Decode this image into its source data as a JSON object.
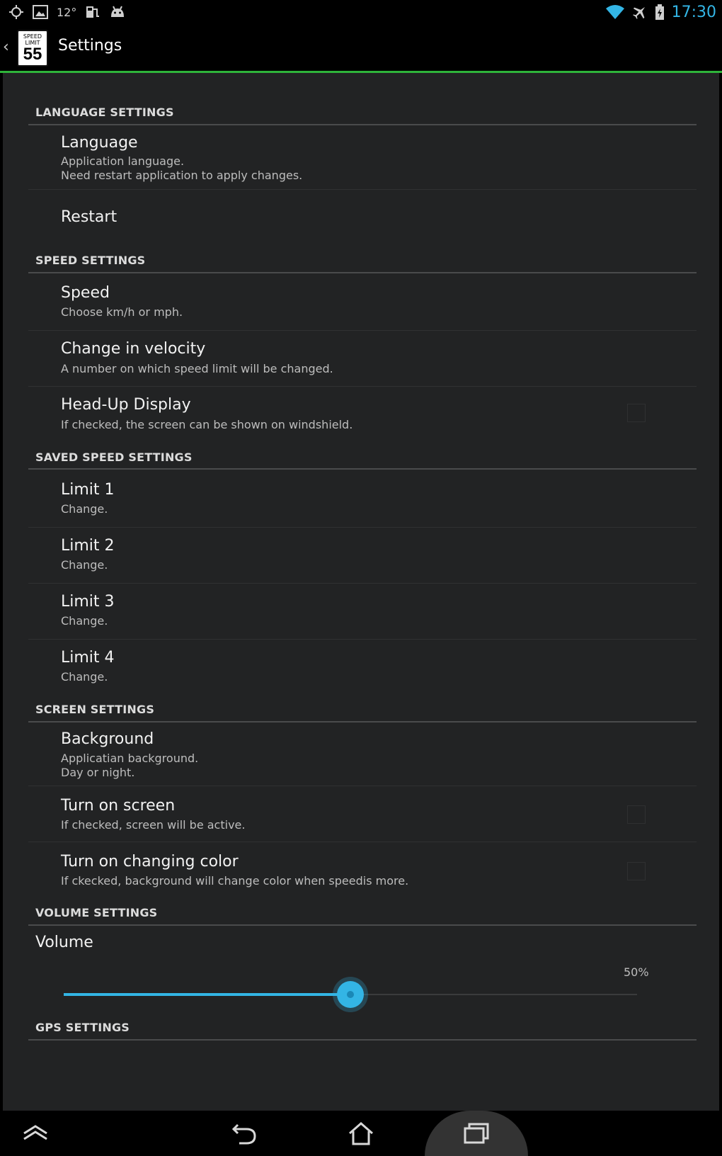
{
  "status_bar": {
    "temperature": "12°",
    "time": "17:30",
    "icons_left": [
      "gps-icon",
      "image-icon",
      "temperature-icon",
      "gas-station-icon",
      "android-icon"
    ],
    "icons_right": [
      "wifi-icon",
      "airplane-icon",
      "battery-icon"
    ]
  },
  "action_bar": {
    "logo": {
      "line1": "SPEED",
      "line2": "LIMIT",
      "number": "55"
    },
    "title": "Settings"
  },
  "sections": [
    {
      "title": "LANGUAGE SETTINGS",
      "items": [
        {
          "title": "Language",
          "summary": [
            "Application language.",
            "Need restart application to apply changes."
          ]
        },
        {
          "title": "Restart",
          "summary": []
        }
      ]
    },
    {
      "title": "SPEED SETTINGS",
      "items": [
        {
          "title": "Speed",
          "summary": [
            "Choose km/h or mph."
          ]
        },
        {
          "title": "Change in velocity",
          "summary": [
            "A number on which speed limit will be changed."
          ]
        },
        {
          "title": "Head-Up Display",
          "summary": [
            "If checked, the screen can be shown on windshield."
          ],
          "checkbox": false
        }
      ]
    },
    {
      "title": "SAVED SPEED SETTINGS",
      "items": [
        {
          "title": "Limit 1",
          "summary": [
            "Change."
          ]
        },
        {
          "title": "Limit 2",
          "summary": [
            "Change."
          ]
        },
        {
          "title": "Limit 3",
          "summary": [
            "Change."
          ]
        },
        {
          "title": "Limit 4",
          "summary": [
            "Change."
          ]
        }
      ]
    },
    {
      "title": "SCREEN SETTINGS",
      "items": [
        {
          "title": "Background",
          "summary": [
            "Applicatian background.",
            "Day or night."
          ]
        },
        {
          "title": "Turn on screen",
          "summary": [
            "If checked, screen will be active."
          ],
          "checkbox": false
        },
        {
          "title": "Turn on changing color",
          "summary": [
            "If ckecked, background will change color when speedis more."
          ],
          "checkbox": false
        }
      ]
    },
    {
      "title": "VOLUME SETTINGS",
      "items": []
    },
    {
      "title": "GPS SETTINGS",
      "items": []
    }
  ],
  "volume": {
    "title": "Volume",
    "value_label": "50%",
    "fraction": 0.5
  },
  "colors": {
    "accent": "#33b5e5",
    "divider_green": "#2fb43a",
    "background": "#222324"
  },
  "nav_bar": {
    "icons": [
      "up-icon",
      "back-icon",
      "home-icon",
      "recents-icon"
    ]
  }
}
